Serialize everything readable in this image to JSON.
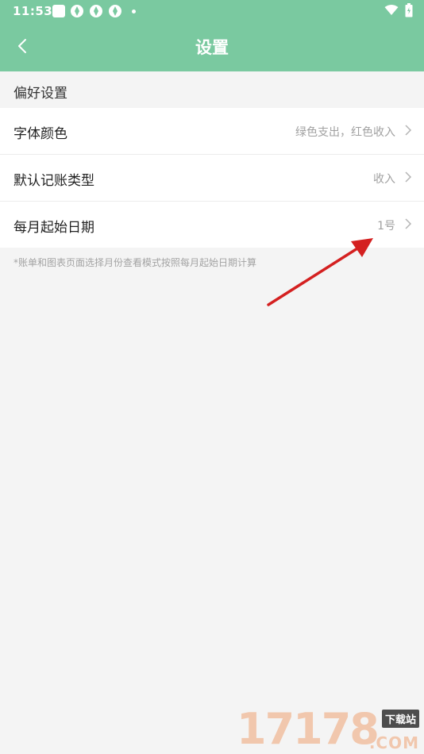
{
  "status_bar": {
    "time": "11:53"
  },
  "header": {
    "title": "设置"
  },
  "section": {
    "title": "偏好设置"
  },
  "settings": [
    {
      "label": "字体颜色",
      "value": "绿色支出，红色收入"
    },
    {
      "label": "默认记账类型",
      "value": "收入"
    },
    {
      "label": "每月起始日期",
      "value": "1号"
    }
  ],
  "footnote": "*账单和图表页面选择月份查看模式按照每月起始日期计算",
  "watermark": {
    "digits": "17178",
    "tag": "下载站",
    "domain": ".COM"
  },
  "colors": {
    "accent": "#7ac9a0",
    "annotation_arrow": "#d42020"
  }
}
